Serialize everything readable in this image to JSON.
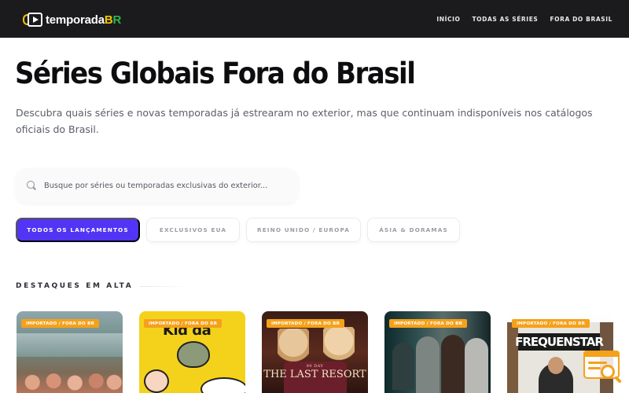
{
  "header": {
    "logo_text": "temporada",
    "logo_accent_b": "B",
    "logo_accent_r": "R",
    "nav": [
      "INÍCIO",
      "TODAS AS SÉRIES",
      "FORA DO BRASIL"
    ]
  },
  "hero": {
    "title": "Séries Globais Fora do Brasil",
    "subtitle": "Descubra quais séries e novas temporadas já estrearam no exterior, mas que continuam indisponíveis nos catálogos oficiais do Brasil."
  },
  "search": {
    "placeholder": "Busque por séries ou temporadas exclusivas do exterior..."
  },
  "filters": [
    "TODOS OS LANÇAMENTOS",
    "EXCLUSIVOS EUA",
    "REINO UNIDO / EUROPA",
    "ÁSIA & DORAMAS"
  ],
  "section": {
    "title": "DESTAQUES EM ALTA"
  },
  "cards": [
    {
      "badge": "IMPORTADO / FORA DO BR"
    },
    {
      "badge": "IMPORTADO / FORA DO BR",
      "poster_text": "Kid da"
    },
    {
      "badge": "IMPORTADO / FORA DO BR",
      "poster_small": "90 DAY",
      "poster_text": "THE LAST RESORT"
    },
    {
      "badge": "IMPORTADO / FORA DO BR"
    },
    {
      "badge": "IMPORTADO / FORA DO BR",
      "poster_text": "FREQUENSTAR"
    }
  ],
  "colors": {
    "accent": "#5234f5",
    "badge": "#f5a11a",
    "topbar": "#1b1b1d",
    "logo_yellow": "#f4c400",
    "logo_green": "#2fb54a"
  },
  "icons": [
    "play-logo-icon",
    "search-icon",
    "search-widget-icon"
  ]
}
